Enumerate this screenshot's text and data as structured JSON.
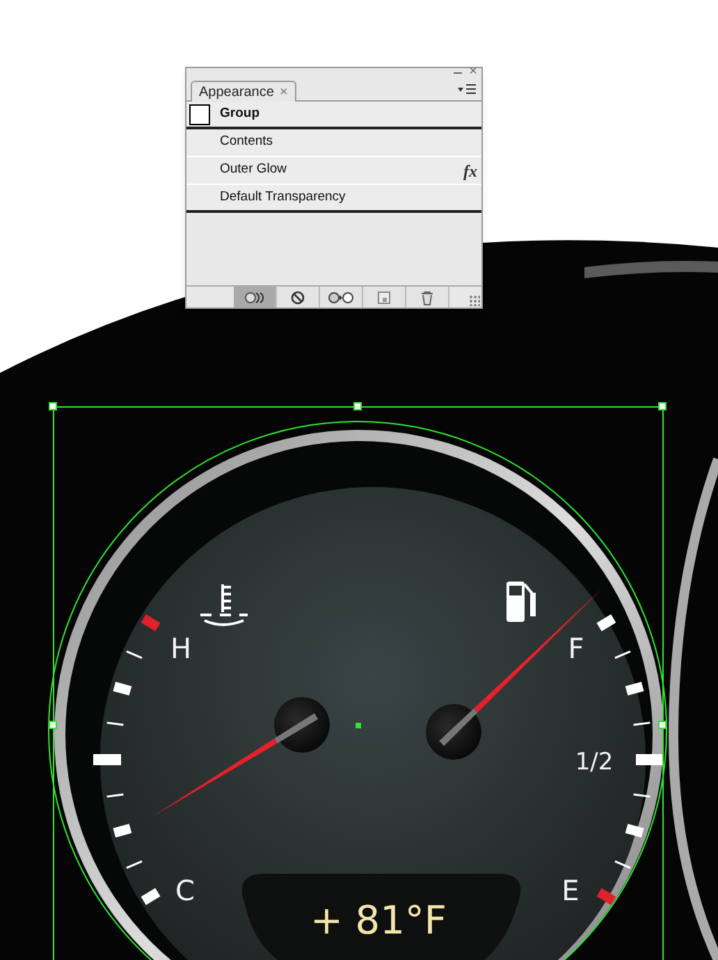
{
  "panel": {
    "close": "×",
    "tab": "Appearance",
    "tab_close": "×",
    "rows": [
      {
        "kind": "header",
        "label": "Group"
      },
      {
        "kind": "item",
        "label": "Contents"
      },
      {
        "kind": "effect",
        "label": "Outer Glow",
        "badge": "fx"
      },
      {
        "kind": "item",
        "label": "Default Transparency"
      }
    ],
    "toolbar": [
      {
        "kind": "clear-appearance",
        "selected": true
      },
      {
        "kind": "prohibit",
        "selected": false
      },
      {
        "kind": "reduce",
        "selected": false
      },
      {
        "kind": "duplicate",
        "selected": false
      },
      {
        "kind": "delete",
        "selected": false
      }
    ]
  },
  "gauge": {
    "temperature": {
      "hot_label": "H",
      "cold_label": "C"
    },
    "fuel": {
      "full_label": "F",
      "half_label": "1/2",
      "empty_label": "E"
    },
    "readout": "+ 81°F"
  }
}
